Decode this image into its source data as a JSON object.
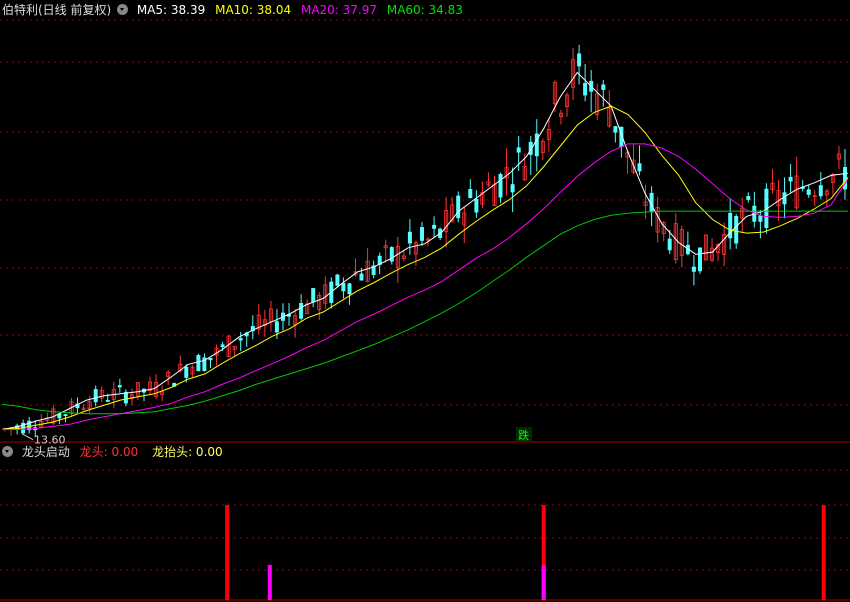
{
  "main_header": {
    "title": "伯特利(日线 前复权)",
    "ma5": "MA5: 38.39",
    "ma10": "MA10: 38.04",
    "ma20": "MA20: 37.97",
    "ma60": "MA60: 34.83"
  },
  "low_label": "13.60",
  "signal_label": "跌",
  "sub_header": {
    "title": "龙头启动",
    "s1": "龙头: 0.00",
    "s2": "龙抬头: 0.00"
  },
  "colors": {
    "up": "#ff3333",
    "down": "#54ffff",
    "ma5": "#ffffff",
    "ma10": "#ffff00",
    "ma20": "#ff00ff",
    "ma60": "#00c800",
    "grid": "#a00000",
    "signal_green": "#00ff00"
  },
  "chart_data": [
    {
      "type": "candlestick",
      "series": [
        {
          "name": "MA5",
          "values": [
            14.0,
            14.3,
            14.8,
            15.2,
            16.0,
            16.8,
            17.2,
            17.4,
            17.6,
            17.9,
            19.0,
            20.2,
            20.6,
            21.6,
            22.8,
            23.6,
            24.3,
            25.0,
            25.9,
            26.5,
            27.8,
            29.0,
            29.5,
            30.3,
            31.3,
            31.7,
            32.8,
            34.8,
            36.0,
            37.2,
            38.4,
            40.0,
            42.6,
            45.7,
            48.0,
            46.4,
            44.8,
            40.4,
            36.5,
            33.6,
            31.8,
            30.7,
            30.9,
            32.7,
            34.3,
            34.8,
            35.9,
            36.9,
            37.5,
            38.2,
            38.4
          ]
        },
        {
          "name": "MA10",
          "values": [
            14.0,
            14.1,
            14.4,
            14.7,
            15.2,
            15.8,
            16.3,
            16.8,
            17.1,
            17.4,
            18.0,
            18.8,
            19.3,
            20.3,
            21.2,
            22.0,
            22.9,
            23.6,
            24.6,
            25.2,
            26.2,
            27.2,
            28.0,
            28.9,
            29.7,
            30.4,
            31.3,
            32.6,
            33.8,
            34.9,
            35.9,
            37.2,
            39.0,
            41.0,
            43.0,
            44.2,
            44.8,
            44.0,
            42.3,
            40.1,
            38.2,
            35.6,
            34.0,
            33.0,
            32.7,
            32.8,
            33.4,
            34.1,
            35.0,
            36.0,
            38.0
          ]
        },
        {
          "name": "MA20",
          "values": [
            14.0,
            14.0,
            14.1,
            14.3,
            14.5,
            14.9,
            15.2,
            15.5,
            15.8,
            16.1,
            16.5,
            17.1,
            17.6,
            18.3,
            18.9,
            19.6,
            20.3,
            21.0,
            21.8,
            22.5,
            23.4,
            24.3,
            25.0,
            25.8,
            26.6,
            27.3,
            28.1,
            29.2,
            30.3,
            31.2,
            32.3,
            33.6,
            35.0,
            36.6,
            38.1,
            39.4,
            40.5,
            41.2,
            41.2,
            40.8,
            40.0,
            38.8,
            37.4,
            36.0,
            34.9,
            34.3,
            34.2,
            34.3,
            34.6,
            35.4,
            37.9
          ]
        },
        {
          "name": "MA60",
          "values": [
            16.4,
            16.2,
            15.9,
            15.7,
            15.6,
            15.5,
            15.5,
            15.5,
            15.6,
            15.7,
            16.0,
            16.3,
            16.7,
            17.2,
            17.7,
            18.3,
            18.8,
            19.3,
            19.8,
            20.3,
            20.9,
            21.5,
            22.1,
            22.8,
            23.5,
            24.3,
            25.1,
            26.0,
            27.0,
            28.1,
            29.2,
            30.4,
            31.5,
            32.6,
            33.4,
            34.0,
            34.4,
            34.6,
            34.7,
            34.8,
            34.8,
            34.8,
            34.8,
            34.8,
            34.8,
            34.8,
            34.8,
            34.8,
            34.8,
            34.8,
            34.8
          ]
        }
      ],
      "price_range": [
        13.0,
        53.0
      ],
      "low_price": 13.6,
      "grid": true
    },
    {
      "type": "bar",
      "series": [
        {
          "name": "龙头",
          "color": "#ff0000",
          "bars": [
            {
              "x": 37
            },
            {
              "x": 89
            },
            {
              "x": 135
            }
          ]
        },
        {
          "name": "龙抬头",
          "color": "#ff00ff",
          "bars": [
            {
              "x": 44
            },
            {
              "x": 89
            }
          ]
        }
      ],
      "value_range": [
        0,
        1
      ],
      "grid": true
    }
  ]
}
